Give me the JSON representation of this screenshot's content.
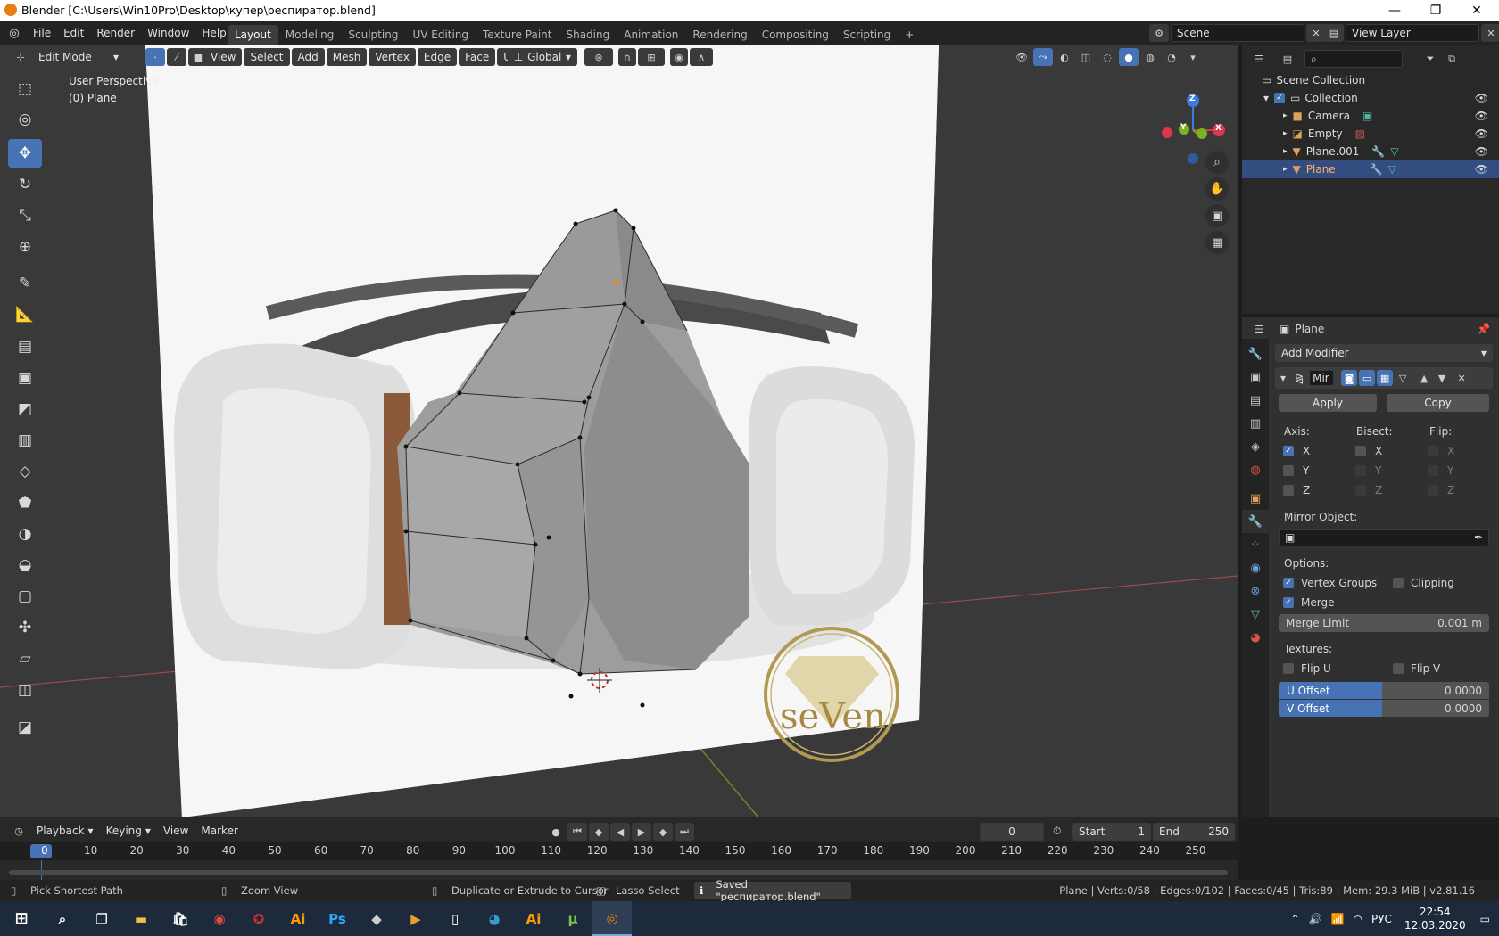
{
  "window": {
    "title": "Blender [C:\\Users\\Win10Pro\\Desktop\\купер\\респиратор.blend]",
    "minimize": "—",
    "maximize": "❐",
    "close": "✕"
  },
  "menubar": {
    "items": [
      "File",
      "Edit",
      "Render",
      "Window",
      "Help"
    ],
    "workspaces": [
      "Layout",
      "Modeling",
      "Sculpting",
      "UV Editing",
      "Texture Paint",
      "Shading",
      "Animation",
      "Rendering",
      "Compositing",
      "Scripting"
    ],
    "active_workspace": "Layout",
    "add_tab": "+",
    "scene_label": "Scene",
    "view_layer_label": "View Layer"
  },
  "viewport_header": {
    "mode": "Edit Mode",
    "menus": [
      "View",
      "Select",
      "Add",
      "Mesh",
      "Vertex",
      "Edge",
      "Face",
      "UV"
    ],
    "orientation": "Global"
  },
  "viewport": {
    "perspective_label": "User Perspective",
    "object_label": "(0) Plane",
    "logo_text": "seVen",
    "gizmo": {
      "x": "X",
      "y": "Y",
      "z": "Z"
    }
  },
  "outliner": {
    "search_placeholder": "",
    "scene_collection": "Scene Collection",
    "collection": "Collection",
    "items": [
      {
        "name": "Camera",
        "color": "#e3a05a"
      },
      {
        "name": "Empty",
        "color": "#e3a05a"
      },
      {
        "name": "Plane.001",
        "color": "#e3a05a"
      },
      {
        "name": "Plane",
        "color": "#e3a05a",
        "selected": true
      }
    ]
  },
  "properties": {
    "object_name": "Plane",
    "add_modifier": "Add Modifier",
    "modifier_name": "Mir",
    "apply": "Apply",
    "copy": "Copy",
    "axis_label": "Axis:",
    "bisect_label": "Bisect:",
    "flip_label": "Flip:",
    "axes": [
      "X",
      "Y",
      "Z"
    ],
    "axis_checked": [
      true,
      false,
      false
    ],
    "mirror_object_label": "Mirror Object:",
    "options_label": "Options:",
    "vertex_groups": "Vertex Groups",
    "clipping": "Clipping",
    "merge": "Merge",
    "merge_limit_label": "Merge Limit",
    "merge_limit_value": "0.001 m",
    "textures_label": "Textures:",
    "flip_u": "Flip U",
    "flip_v": "Flip V",
    "u_offset_label": "U Offset",
    "u_offset_value": "0.0000",
    "v_offset_label": "V Offset",
    "v_offset_value": "0.0000"
  },
  "timeline": {
    "menus": [
      "Playback",
      "Keying",
      "View",
      "Marker"
    ],
    "current_frame": "0",
    "start_label": "Start",
    "start_value": "1",
    "end_label": "End",
    "end_value": "250",
    "ticks": [
      "0",
      "10",
      "20",
      "30",
      "40",
      "50",
      "60",
      "70",
      "80",
      "90",
      "100",
      "110",
      "120",
      "130",
      "140",
      "150",
      "160",
      "170",
      "180",
      "190",
      "200",
      "210",
      "220",
      "230",
      "240",
      "250"
    ]
  },
  "statusbar": {
    "hint1": "Pick Shortest Path",
    "hint2": "Zoom View",
    "hint3": "Duplicate or Extrude to Cursor",
    "hint4": "Lasso Select",
    "message": "Saved \"респиратор.blend\"",
    "stats": "Plane | Verts:0/58 | Edges:0/102 | Faces:0/45 | Tris:89 | Mem: 29.3 MiB | v2.81.16"
  },
  "taskbar": {
    "lang": "РУС",
    "time": "22:54",
    "date": "12.03.2020"
  },
  "colors": {
    "accent": "#4772b3",
    "selected_row": "#334d80",
    "outliner_bg": "#282828",
    "viewport_bg": "#393939"
  }
}
